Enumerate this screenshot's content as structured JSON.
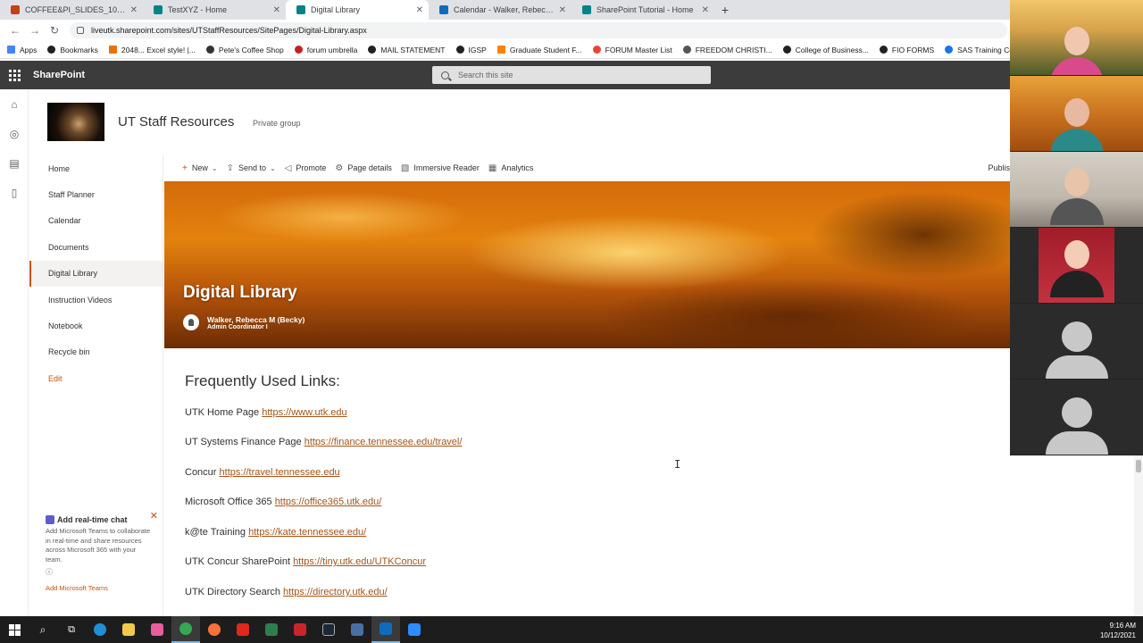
{
  "browser": {
    "tabs": [
      {
        "label": "COFFEE&PI_SLIDES_10-12-21.pp",
        "color": "#c43e1c"
      },
      {
        "label": "TestXYZ - Home",
        "color": "#038387"
      },
      {
        "label": "Digital Library",
        "color": "#038387"
      },
      {
        "label": "Calendar - Walker, Rebecca M (li",
        "color": "#0f6cbd"
      },
      {
        "label": "SharePoint Tutorial - Home",
        "color": "#038387"
      }
    ],
    "url": "liveutk.sharepoint.com/sites/UTStaffResources/SitePages/Digital-Library.aspx",
    "bookmarks": [
      "Apps",
      "Bookmarks",
      "2048... Excel style! |...",
      "Pete's Coffee Shop",
      "forum umbrella",
      "MAIL STATEMENT",
      "IGSP",
      "Graduate Student F...",
      "FORUM Master List",
      "FREEDOM CHRISTI...",
      "College of Business...",
      "FIO FORMS",
      "SAS Training Center..."
    ]
  },
  "suite": {
    "brand": "SharePoint",
    "search_placeholder": "Search this site"
  },
  "site": {
    "title": "UT Staff Resources",
    "privacy": "Private group"
  },
  "nav": {
    "items": [
      "Home",
      "Staff Planner",
      "Calendar",
      "Documents",
      "Digital Library",
      "Instruction Videos",
      "Notebook",
      "Recycle bin"
    ],
    "edit": "Edit"
  },
  "teams_promo": {
    "title": "Add real-time chat",
    "desc": "Add Microsoft Teams to collaborate in real-time and share resources across Microsoft 365 with your team.",
    "link": "Add Microsoft Teams"
  },
  "commands": {
    "new": "New",
    "send_to": "Send to",
    "promote": "Promote",
    "page_details": "Page details",
    "immersive_reader": "Immersive Reader",
    "analytics": "Analytics",
    "publish": "Publis"
  },
  "banner": {
    "title": "Digital Library",
    "author": "Walker, Rebecca M (Becky)",
    "role": "Admin Coordinator I"
  },
  "content": {
    "heading": "Frequently Used Links:",
    "links": [
      {
        "label": "UTK Home Page",
        "url": "https://www.utk.edu"
      },
      {
        "label": "UT Systems Finance Page",
        "url": "https://finance.tennessee.edu/travel/"
      },
      {
        "label": "Concur",
        "url": "https://travel.tennessee.edu"
      },
      {
        "label": "Microsoft Office 365",
        "url": "https://office365.utk.edu/"
      },
      {
        "label": "k@te Training",
        "url": "https://kate.tennessee.edu/"
      },
      {
        "label": "UTK Concur SharePoint",
        "url": "https://tiny.utk.edu/UTKConcur"
      },
      {
        "label": "UTK Directory Search",
        "url": "https://directory.utk.edu/"
      }
    ]
  },
  "taskbar": {
    "time": "9:16 AM",
    "date": "10/12/2021"
  }
}
